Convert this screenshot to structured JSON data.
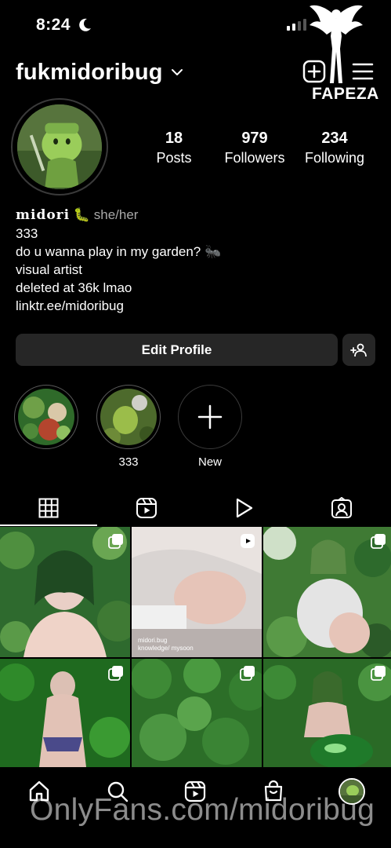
{
  "status_bar": {
    "time": "8:24"
  },
  "header": {
    "username": "fukmidoribug"
  },
  "watermark": {
    "top_text": "FAPEZA",
    "bottom_text": "OnlyFans.com/midoribug"
  },
  "stats": [
    {
      "value": "18",
      "label": "Posts"
    },
    {
      "value": "979",
      "label": "Followers"
    },
    {
      "value": "234",
      "label": "Following"
    }
  ],
  "bio": {
    "display_name": "midori",
    "name_emoji": "🐛",
    "pronouns": "she/her",
    "lines": [
      "333",
      "do u wanna play in my garden? 🐜",
      "visual artist",
      "deleted at 36k lmao"
    ],
    "link": "linktr.ee/midoribug"
  },
  "buttons": {
    "edit_profile": "Edit Profile"
  },
  "highlights": [
    {
      "label": "",
      "kind": "image"
    },
    {
      "label": "333",
      "kind": "image"
    },
    {
      "label": "New",
      "kind": "new"
    }
  ],
  "tabs": [
    "grid-icon",
    "reels-icon",
    "play-icon",
    "tagged-icon"
  ],
  "grid_overlay": {
    "handle": "midori.bug",
    "audio": "knowledge/ mysoon"
  },
  "colors": {
    "background": "#000000",
    "button": "#262626",
    "accent_green": "#3f7a34"
  }
}
